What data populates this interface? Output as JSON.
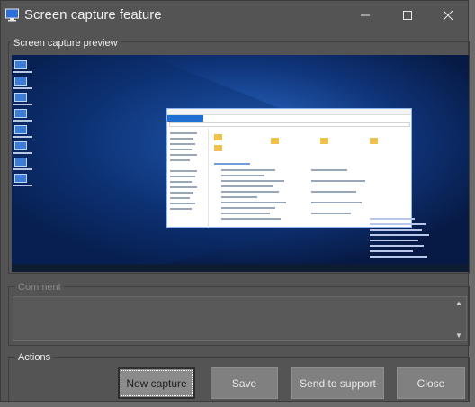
{
  "window": {
    "title": "Screen capture feature",
    "icon": "monitor-icon",
    "controls": {
      "minimize": "minimize-icon",
      "maximize": "maximize-icon",
      "close": "close-icon"
    }
  },
  "preview": {
    "label": "Screen capture preview"
  },
  "comment": {
    "label": "Comment",
    "value": ""
  },
  "actions": {
    "label": "Actions",
    "buttons": {
      "new_capture": "New capture",
      "save": "Save",
      "send_to_support": "Send to support",
      "close": "Close"
    }
  },
  "colors": {
    "window_bg": "#545454",
    "button_bg": "#808080",
    "desktop_bg": "#0c2a66",
    "explorer_accent": "#1e6fd1"
  }
}
